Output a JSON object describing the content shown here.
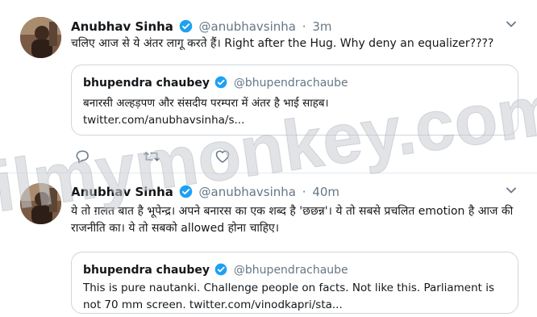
{
  "tweets": [
    {
      "author_name": "Anubhav Sinha",
      "handle": "@anubhavsinha",
      "separator": "·",
      "time": "3m",
      "text": "चलिए आज से ये अंतर लागू करते हैं। Right after the Hug. Why deny an equalizer????",
      "quote": {
        "author_name": "bhupendra chaubey",
        "handle": "@bhupendrachaube",
        "text": "बनारसी अल्हड़पण और संसदीय परम्परा में अंतर है भाई साहब।",
        "link": "twitter.com/anubhavsinha/s..."
      }
    },
    {
      "author_name": "Anubhav Sinha",
      "handle": "@anubhavsinha",
      "separator": "·",
      "time": "40m",
      "text": "ये तो ग़लत बात है भूपेन्द्र। अपने बनारस का एक शब्द है 'छछन्न'। ये तो सबसे प्रचलित emotion है आज की राजनीति का। ये तो सबको allowed होना चाहिए।",
      "quote": {
        "author_name": "bhupendra chaubey",
        "handle": "@bhupendrachaube",
        "text": "This is pure nautanki. Challenge people on facts. Not like this. Parliament is not 70 mm screen. twitter.com/vinodkapri/sta..."
      }
    }
  ],
  "watermark": "filmymonkey.com",
  "colors": {
    "text": "#14171a",
    "secondary": "#657786",
    "verified": "#1da1f2",
    "border": "#ccd6dd",
    "watermark": "#c9ccd1"
  },
  "icons": [
    "verified-badge-icon",
    "chevron-down-icon",
    "reply-icon",
    "retweet-icon",
    "like-icon"
  ]
}
